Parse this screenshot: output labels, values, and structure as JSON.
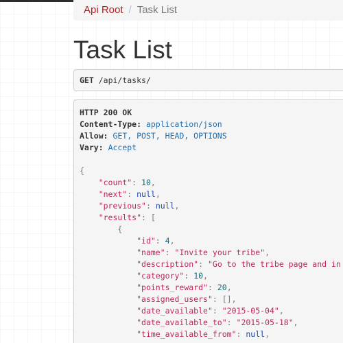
{
  "breadcrumb": {
    "root_label": "Api Root",
    "separator": "/",
    "current_label": "Task List"
  },
  "page": {
    "title": "Task List"
  },
  "request": {
    "method": "GET",
    "path": "/api/tasks/"
  },
  "response": {
    "status_line": "HTTP 200 OK",
    "headers": [
      {
        "name": "Content-Type:",
        "value": "application/json"
      },
      {
        "name": "Allow:",
        "value": "GET, POST, HEAD, OPTIONS"
      },
      {
        "name": "Vary:",
        "value": "Accept"
      }
    ],
    "body": {
      "count": "10",
      "next": "null",
      "previous": "null",
      "results_open": "[",
      "item": {
        "id": "4",
        "name": "\"Invite your tribe\"",
        "description": "\"Go to the tribe page and in",
        "category": "10",
        "points_reward": "20",
        "assigned_users": "[]",
        "date_available": "\"2015-05-04\"",
        "date_available_to": "\"2015-05-18\"",
        "time_available_from": "null"
      }
    }
  },
  "colors": {
    "link": "#b71c1c",
    "json_key": "#c0245c",
    "json_string": "#c0245c",
    "json_number": "#116677",
    "json_literal": "#1f4aa0",
    "header_value": "#1f6fb2",
    "panel_bg": "#f5f5f5",
    "top_bar": "#2c2c2c"
  }
}
